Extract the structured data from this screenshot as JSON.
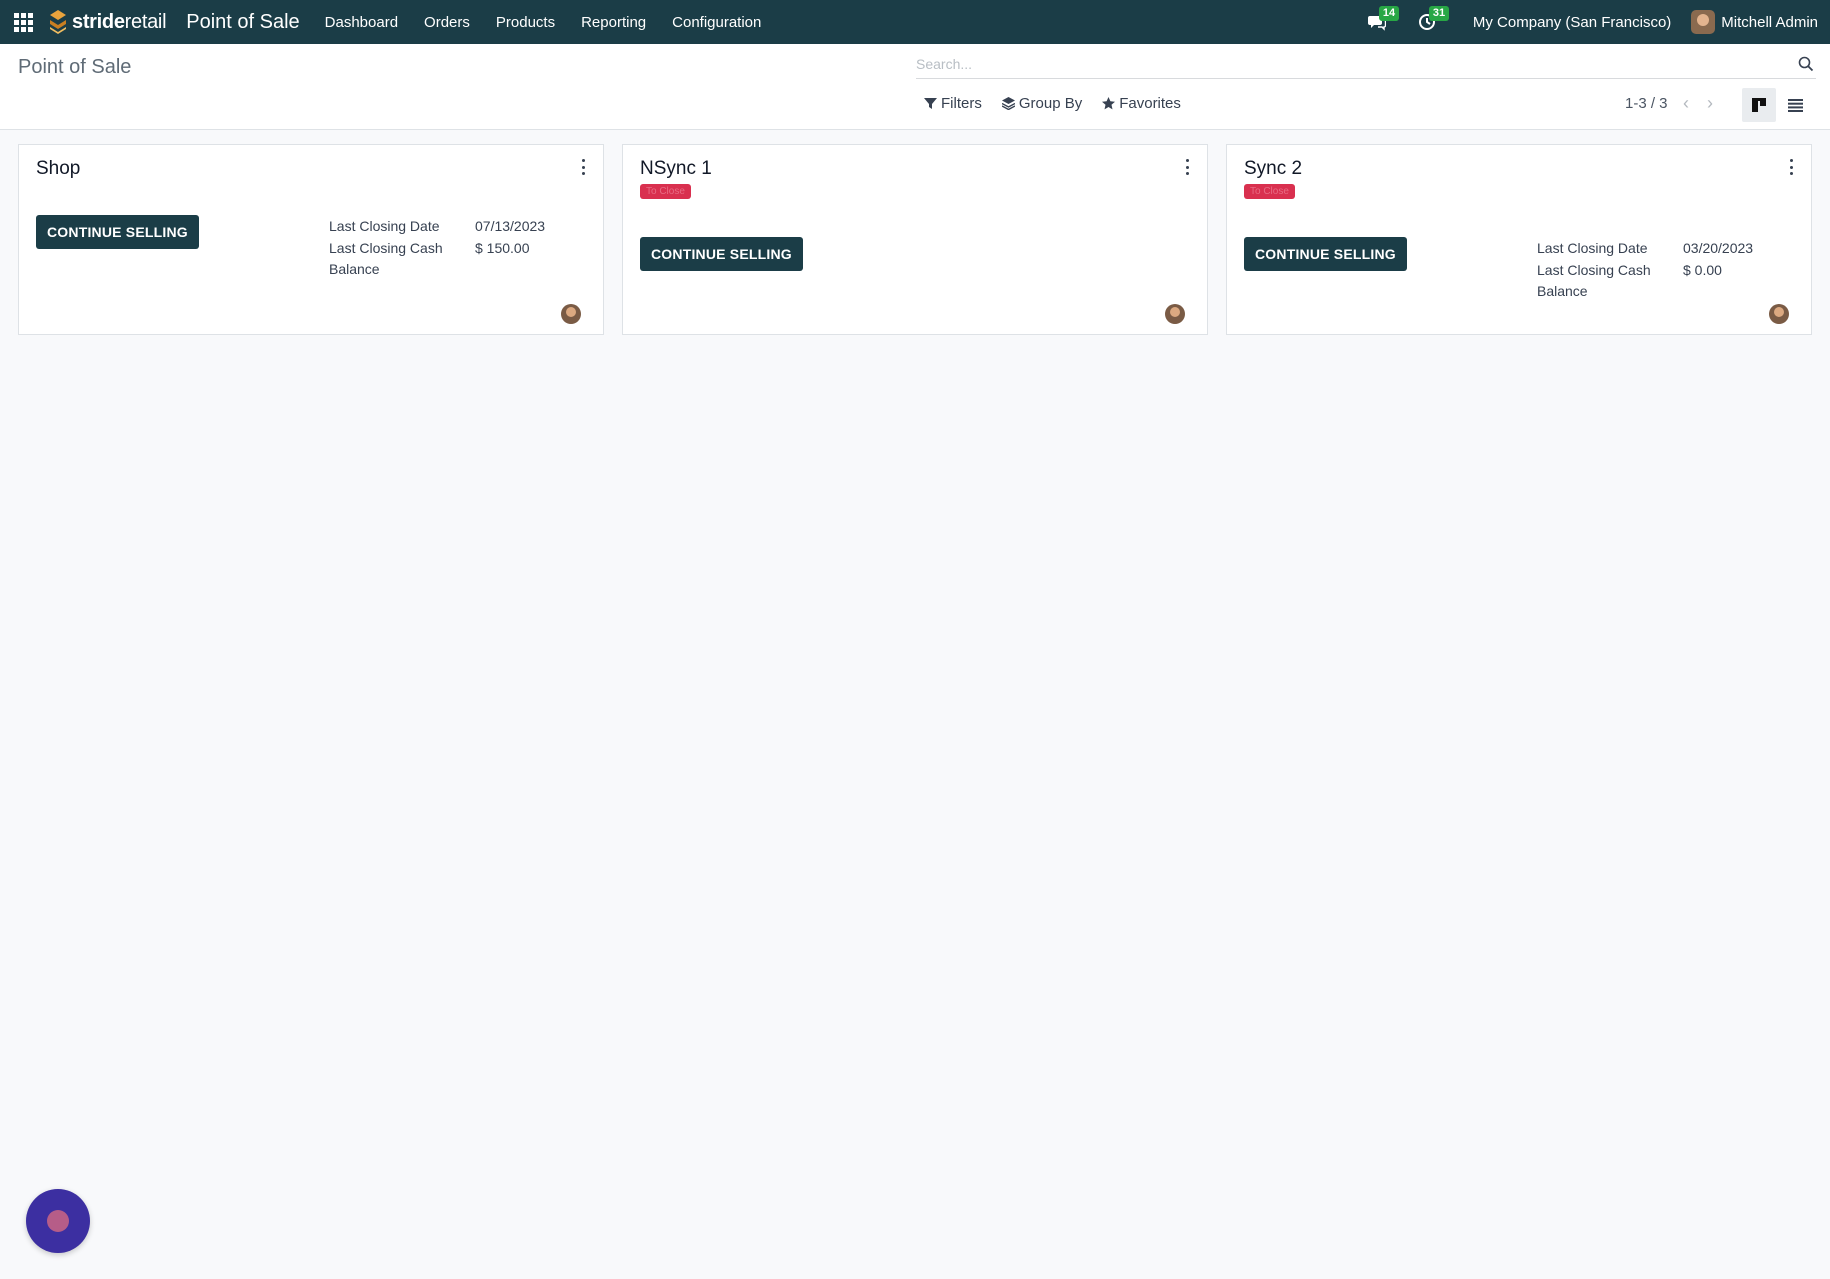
{
  "navbar": {
    "brand_bold": "stride",
    "brand_light": "retail",
    "app_title": "Point of Sale",
    "menu": [
      "Dashboard",
      "Orders",
      "Products",
      "Reporting",
      "Configuration"
    ],
    "messages_count": "14",
    "activities_count": "31",
    "company": "My Company (San Francisco)",
    "user": "Mitchell Admin"
  },
  "control": {
    "breadcrumb": "Point of Sale",
    "search_placeholder": "Search...",
    "filters_label": "Filters",
    "groupby_label": "Group By",
    "favorites_label": "Favorites",
    "pager": "1-3 / 3"
  },
  "cards": [
    {
      "title": "Shop",
      "tag": "",
      "button": "CONTINUE SELLING",
      "closing_date_label": "Last Closing Date",
      "closing_date": "07/13/2023",
      "closing_cash_label": "Last Closing Cash Balance",
      "closing_cash": "$ 150.00"
    },
    {
      "title": "NSync 1",
      "tag": "To Close",
      "button": "CONTINUE SELLING"
    },
    {
      "title": "Sync 2",
      "tag": "To Close",
      "button": "CONTINUE SELLING",
      "closing_date_label": "Last Closing Date",
      "closing_date": "03/20/2023",
      "closing_cash_label": "Last Closing Cash Balance",
      "closing_cash": "$ 0.00"
    }
  ],
  "colors": {
    "navbar": "#1b3d47",
    "primary_button": "#1b3d47",
    "tag_red": "#d9304f",
    "badge_green": "#28a745",
    "chat_bubble": "#3c2fa1"
  }
}
